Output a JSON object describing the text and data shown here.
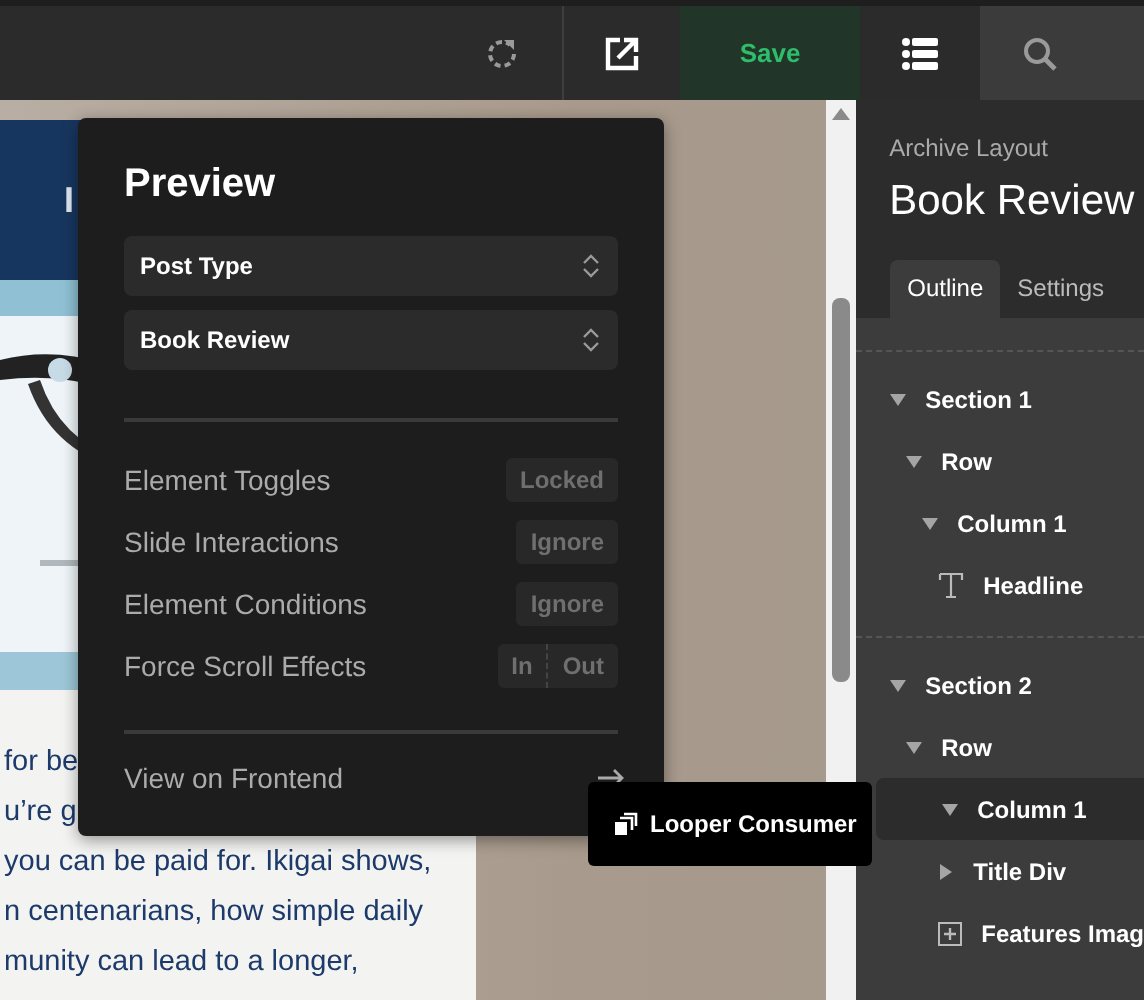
{
  "toolbar": {
    "save_label": "Save"
  },
  "canvas": {
    "header_text": "I",
    "body_lines": [
      "for be",
      "u’re g",
      "you can be paid for. Ikigai shows,",
      "n centenarians, how simple daily",
      "munity can lead to a longer,"
    ]
  },
  "preview_panel": {
    "title": "Preview",
    "selects": [
      {
        "value": "Post Type"
      },
      {
        "value": "Book Review"
      }
    ],
    "options": [
      {
        "label": "Element Toggles",
        "kind": "badge",
        "badge": "Locked"
      },
      {
        "label": "Slide Interactions",
        "kind": "badge",
        "badge": "Ignore"
      },
      {
        "label": "Element Conditions",
        "kind": "badge",
        "badge": "Ignore"
      },
      {
        "label": "Force Scroll Effects",
        "kind": "segmented",
        "segments": [
          "In",
          "Out"
        ]
      }
    ],
    "link": "View on Frontend"
  },
  "tooltip": {
    "label": "Looper Consumer"
  },
  "sidebar": {
    "subtitle": "Archive Layout",
    "title": "Book Review",
    "tabs": [
      {
        "label": "Outline",
        "selected": true
      },
      {
        "label": "Settings",
        "selected": false
      }
    ],
    "outline": [
      {
        "label": "Section 1",
        "kind": "container",
        "expanded": true,
        "selected": false,
        "children": [
          {
            "label": "Row",
            "kind": "container",
            "expanded": true,
            "selected": false,
            "children": [
              {
                "label": "Column 1",
                "kind": "container",
                "expanded": true,
                "selected": false,
                "children": [
                  {
                    "label": "Headline",
                    "kind": "text",
                    "selected": false
                  }
                ]
              }
            ]
          }
        ]
      },
      {
        "label": "Section 2",
        "kind": "container",
        "expanded": true,
        "selected": false,
        "children": [
          {
            "label": "Row",
            "kind": "container",
            "expanded": true,
            "selected": false,
            "children": [
              {
                "label": "Column 1",
                "kind": "container",
                "expanded": true,
                "selected": true,
                "children": [
                  {
                    "label": "Title Div",
                    "kind": "container",
                    "expanded": false,
                    "selected": false
                  },
                  {
                    "label": "Features Imag",
                    "kind": "element",
                    "selected": false
                  }
                ]
              }
            ]
          }
        ]
      }
    ]
  }
}
